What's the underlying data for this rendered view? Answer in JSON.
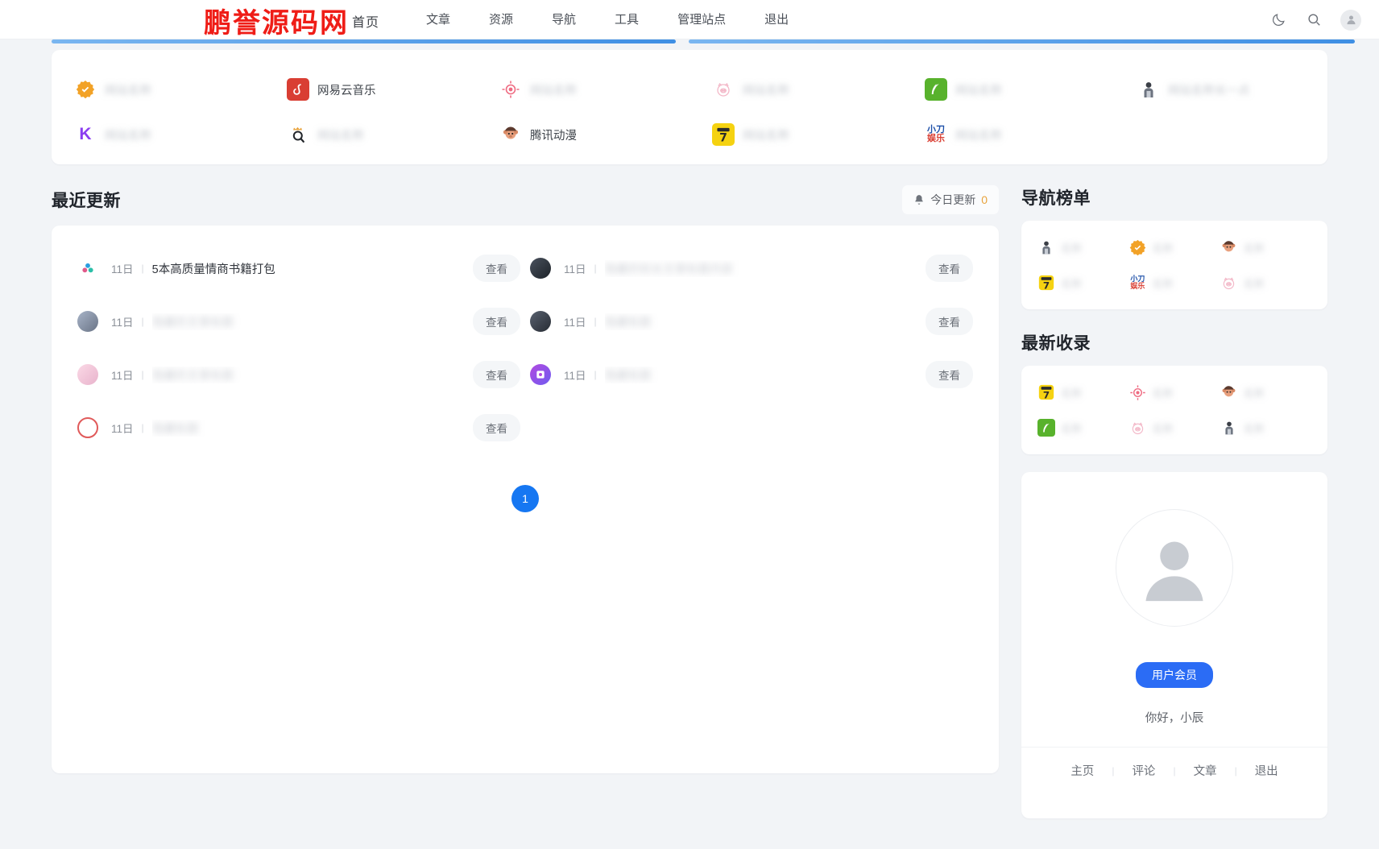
{
  "header": {
    "brand": "首页",
    "watermark": "鹏誉源码网",
    "watermark_boxed": "网",
    "nav": [
      {
        "label": "文章",
        "name": "nav-articles"
      },
      {
        "label": "资源",
        "name": "nav-resources"
      },
      {
        "label": "导航",
        "name": "nav-navigation"
      },
      {
        "label": "工具",
        "name": "nav-tools"
      },
      {
        "label": "管理站点",
        "name": "nav-admin"
      },
      {
        "label": "退出",
        "name": "nav-logout"
      }
    ],
    "icons": {
      "theme": "moon-icon",
      "search": "search-icon",
      "avatar": "user-avatar-icon"
    }
  },
  "quick_links": {
    "row1": [
      {
        "label": "",
        "blurred": true,
        "glyph": "✔",
        "bg": "#f2a227",
        "shape": "badge"
      },
      {
        "label": "网易云音乐",
        "blurred": false,
        "glyph": "♪",
        "bg": "#d93e33",
        "shape": "square"
      },
      {
        "label": "",
        "blurred": true,
        "glyph": "◎",
        "bg": "transparent",
        "shape": "target"
      },
      {
        "label": "",
        "blurred": true,
        "glyph": "∞",
        "bg": "transparent",
        "shape": "pig"
      },
      {
        "label": "",
        "blurred": true,
        "glyph": "≋",
        "bg": "#58b22c",
        "shape": "square"
      },
      {
        "label": "",
        "blurred": true,
        "glyph": "👤",
        "bg": "transparent",
        "shape": "person"
      }
    ],
    "row2": [
      {
        "label": "",
        "blurred": true,
        "glyph": "K",
        "bg": "transparent",
        "shape": "letter-purple"
      },
      {
        "label": "",
        "blurred": true,
        "glyph": "Q",
        "bg": "transparent",
        "shape": "crown-q"
      },
      {
        "label": "腾讯动漫",
        "blurred": false,
        "glyph": "🐵",
        "bg": "transparent",
        "shape": "monkey"
      },
      {
        "label": "",
        "blurred": true,
        "glyph": "7",
        "bg": "#f5d211",
        "shape": "square-dark"
      },
      {
        "label": "",
        "blurred": true,
        "glyph": "小刀娱乐",
        "bg": "transparent",
        "shape": "xiaodao"
      },
      {
        "label": "",
        "blurred": true,
        "glyph": "",
        "bg": "transparent",
        "shape": "none"
      }
    ]
  },
  "recent": {
    "title": "最近更新",
    "today_label": "今日更新",
    "today_count": "0",
    "view_label": "查看",
    "page_current": "1",
    "left_rows": [
      {
        "date": "11日",
        "title": "5本高质量情商书籍打包",
        "blurred": false,
        "icon": "cloud-share-icon",
        "icon_bg": "#e8f3fb"
      },
      {
        "date": "11日",
        "title": "",
        "blurred": true,
        "icon": "anime-avatar-icon",
        "icon_bg": "#cfd6e2"
      },
      {
        "date": "11日",
        "title": "",
        "blurred": true,
        "icon": "anime-girl-icon",
        "icon_bg": "#f6dce6"
      },
      {
        "date": "11日",
        "title": "",
        "blurred": true,
        "icon": "red-circle-icon",
        "icon_bg": "#f7dede"
      }
    ],
    "right_rows": [
      {
        "date": "11日",
        "title": "",
        "blurred": true,
        "icon": "dark-avatar-icon",
        "icon_bg": "#2b3138"
      },
      {
        "date": "11日",
        "title": "",
        "blurred": true,
        "icon": "dark-portrait-icon",
        "icon_bg": "#363b44"
      },
      {
        "date": "11日",
        "title": "",
        "blurred": true,
        "icon": "photo-app-icon",
        "icon_bg": "#b24ae0"
      }
    ]
  },
  "sidebar": {
    "rank_title": "导航榜单",
    "rank_items": [
      {
        "label": "",
        "shape": "person",
        "bg": "transparent"
      },
      {
        "label": "",
        "shape": "badge",
        "bg": "#f2a227"
      },
      {
        "label": "",
        "shape": "monkey",
        "bg": "transparent"
      },
      {
        "label": "",
        "shape": "square-dark",
        "bg": "#f5d211"
      },
      {
        "label": "",
        "shape": "xiaodao",
        "bg": "transparent"
      },
      {
        "label": "",
        "shape": "pig",
        "bg": "transparent"
      }
    ],
    "latest_title": "最新收录",
    "latest_items": [
      {
        "label": "",
        "shape": "square-dark",
        "bg": "#f5d211"
      },
      {
        "label": "",
        "shape": "target",
        "bg": "transparent"
      },
      {
        "label": "",
        "shape": "monkey",
        "bg": "transparent"
      },
      {
        "label": "",
        "shape": "square",
        "bg": "#58b22c"
      },
      {
        "label": "",
        "shape": "pig",
        "bg": "transparent"
      },
      {
        "label": "",
        "shape": "person",
        "bg": "transparent"
      }
    ],
    "user": {
      "member_badge": "用户会员",
      "greeting": "你好，小辰",
      "links": [
        {
          "label": "主页",
          "name": "user-link-home"
        },
        {
          "label": "评论",
          "name": "user-link-comments"
        },
        {
          "label": "文章",
          "name": "user-link-articles"
        },
        {
          "label": "退出",
          "name": "user-link-logout"
        }
      ]
    }
  },
  "colors": {
    "accent": "#1677f2",
    "badge_blue": "#2b6cf5",
    "watermark_red": "#ef1d17",
    "page_bg": "#f2f4f7"
  }
}
